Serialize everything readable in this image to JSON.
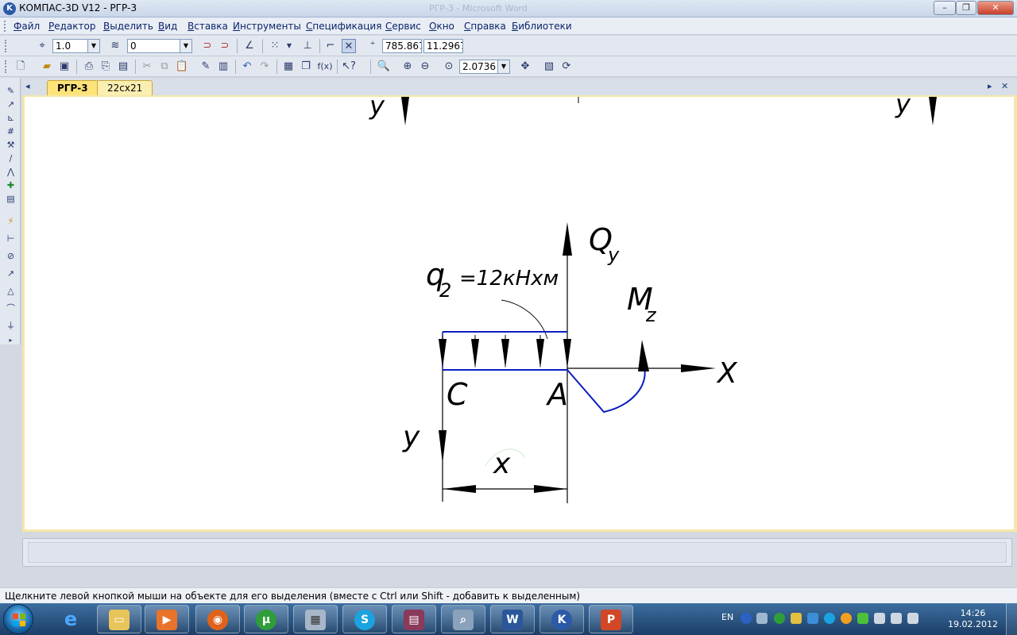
{
  "window": {
    "title": "КОМПАС-3D V12 - РГР-3",
    "ghost_title": "РГР-3 - Microsoft Word",
    "logo_letter": "K",
    "minimize": "–",
    "restore": "❐",
    "close": "✕"
  },
  "menu": [
    "Файл",
    "Редактор",
    "Выделить",
    "Вид",
    "Вставка",
    "Инструменты",
    "Спецификация",
    "Сервис",
    "Окно",
    "Справка",
    "Библиотеки"
  ],
  "toolbar1": {
    "step_value": "1.0",
    "layer_value": "0",
    "coord_x": "785.867",
    "coord_y": "11.2967"
  },
  "toolbar2": {
    "zoom_value": "2.0736",
    "fx_label": "f(x)"
  },
  "tabs": [
    "РГР-3",
    "22сх21"
  ],
  "drawing": {
    "top_left_label": "y",
    "top_right_label": "y",
    "axis_qy_main": "Q",
    "axis_qy_sub": "y",
    "load_main": "q",
    "load_sub": "2",
    "load_value": "=12кНхм",
    "moment_main": "M",
    "moment_sub": "z",
    "axis_x_label": "X",
    "point_c": "C",
    "point_a": "A",
    "axis_y_label": "y",
    "dim_x_label": "x"
  },
  "status": {
    "message": "Щелкните левой кнопкой мыши на объекте для его выделения (вместе с Ctrl или Shift - добавить к выделенным)"
  },
  "taskbar": {
    "language": "EN",
    "time": "14:26",
    "date": "19.02.2012"
  },
  "colors": {
    "load_line": "#0a1fbf",
    "drawing_ink": "#000000",
    "canvas_frame": "#f5e7a8",
    "active_tab": "#fde37a"
  }
}
